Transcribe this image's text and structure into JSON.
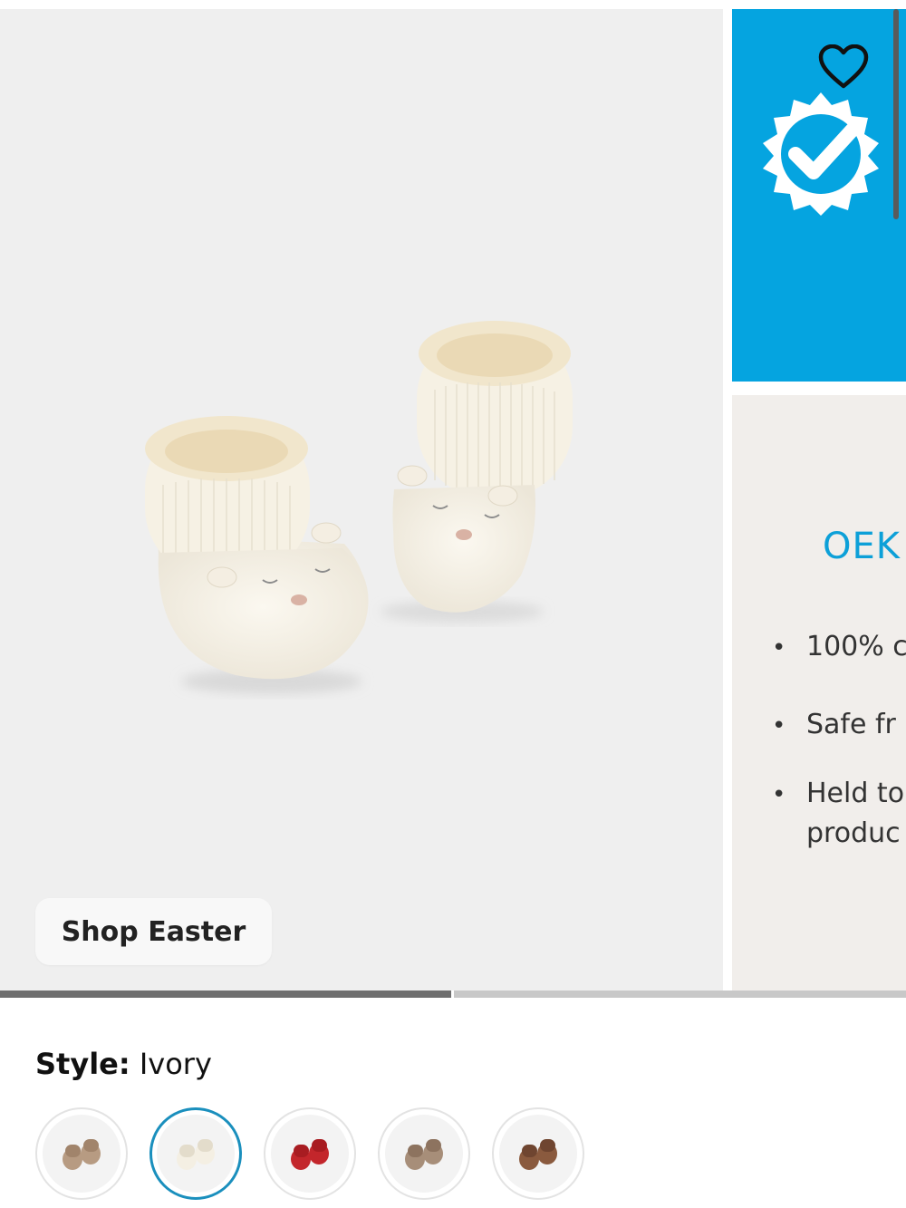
{
  "gallery": {
    "shop_button_label": "Shop Easter",
    "slide_count": 2,
    "current_slide": 1
  },
  "side_panel": {
    "heading": "OEK",
    "bullets": [
      [
        "100% c"
      ],
      [
        "Safe fr"
      ],
      [
        "Held to",
        "produc"
      ]
    ],
    "colors": {
      "blue": "#05a4e0",
      "heading": "#0da0d8",
      "info_bg": "#f1eeeb"
    }
  },
  "style": {
    "label": "Style:",
    "selected_value": "Ivory",
    "swatches": [
      {
        "color": "#b79b82",
        "accent": "#a1846b"
      },
      {
        "color": "#f4efe3",
        "accent": "#e3dccb"
      },
      {
        "color": "#c3262b",
        "accent": "#a81c21"
      },
      {
        "color": "#a78e79",
        "accent": "#8d735f"
      },
      {
        "color": "#8a5a3e",
        "accent": "#6f4530"
      }
    ],
    "selected_index": 1
  },
  "icons": {
    "heart": "heart-outline-icon",
    "badge": "verified-check-badge-icon"
  }
}
